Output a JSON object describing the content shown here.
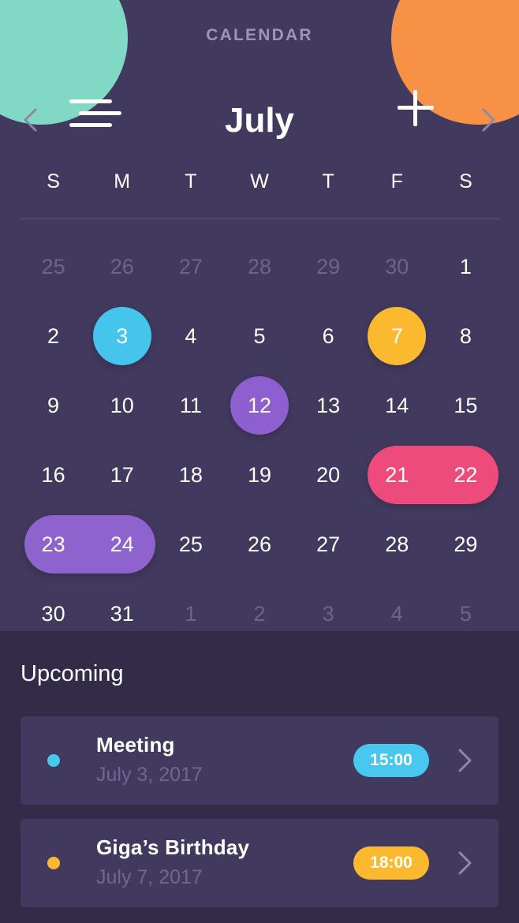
{
  "header": {
    "title": "CALENDAR",
    "menu_icon": "hamburger-menu-icon",
    "add_icon": "plus-icon",
    "menu_color": "#80D8C5",
    "add_color": "#F79145",
    "title_color": "#9C95B6"
  },
  "month_nav": {
    "month": "July",
    "prev_icon": "chevron-left-icon",
    "next_icon": "chevron-right-icon"
  },
  "weekdays": [
    "S",
    "M",
    "T",
    "W",
    "T",
    "F",
    "S"
  ],
  "days": [
    {
      "label": "25",
      "muted": true
    },
    {
      "label": "26",
      "muted": true
    },
    {
      "label": "27",
      "muted": true
    },
    {
      "label": "28",
      "muted": true
    },
    {
      "label": "29",
      "muted": true
    },
    {
      "label": "30",
      "muted": true
    },
    {
      "label": "1",
      "muted": false
    },
    {
      "label": "2",
      "muted": false
    },
    {
      "label": "3",
      "muted": false,
      "marker": "single",
      "color": "#45C4EC"
    },
    {
      "label": "4",
      "muted": false
    },
    {
      "label": "5",
      "muted": false
    },
    {
      "label": "6",
      "muted": false
    },
    {
      "label": "7",
      "muted": false,
      "marker": "single",
      "color": "#FAB92F"
    },
    {
      "label": "8",
      "muted": false
    },
    {
      "label": "9",
      "muted": false
    },
    {
      "label": "10",
      "muted": false
    },
    {
      "label": "11",
      "muted": false
    },
    {
      "label": "12",
      "muted": false,
      "marker": "single",
      "color": "#8E5FCE"
    },
    {
      "label": "13",
      "muted": false
    },
    {
      "label": "14",
      "muted": false
    },
    {
      "label": "15",
      "muted": false
    },
    {
      "label": "16",
      "muted": false
    },
    {
      "label": "17",
      "muted": false
    },
    {
      "label": "18",
      "muted": false
    },
    {
      "label": "19",
      "muted": false
    },
    {
      "label": "20",
      "muted": false
    },
    {
      "label": "21",
      "muted": false,
      "marker": "span2",
      "color": "#EC4B7B"
    },
    {
      "label": "22",
      "muted": false
    },
    {
      "label": "23",
      "muted": false,
      "marker": "span2",
      "color": "#8E63CE"
    },
    {
      "label": "24",
      "muted": false
    },
    {
      "label": "25",
      "muted": false
    },
    {
      "label": "26",
      "muted": false
    },
    {
      "label": "27",
      "muted": false
    },
    {
      "label": "28",
      "muted": false
    },
    {
      "label": "29",
      "muted": false
    },
    {
      "label": "30",
      "muted": false
    },
    {
      "label": "31",
      "muted": false
    },
    {
      "label": "1",
      "muted": true
    },
    {
      "label": "2",
      "muted": true
    },
    {
      "label": "3",
      "muted": true
    },
    {
      "label": "4",
      "muted": true
    },
    {
      "label": "5",
      "muted": true
    }
  ],
  "upcoming": {
    "heading": "Upcoming",
    "events": [
      {
        "name": "Meeting",
        "date": "July 3, 2017",
        "time": "15:00",
        "color": "#48C8EE",
        "chevron_icon": "chevron-right-icon"
      },
      {
        "name": "Giga’s Birthday",
        "date": "July 7, 2017",
        "time": "18:00",
        "color": "#FAB92F",
        "chevron_icon": "chevron-right-icon"
      }
    ]
  },
  "colors": {
    "calendar_bg": "#42395E",
    "upcoming_bg": "#332C49",
    "card_bg": "#413A5E",
    "muted_text": "#6C648A",
    "date_text": "#6F6790"
  }
}
